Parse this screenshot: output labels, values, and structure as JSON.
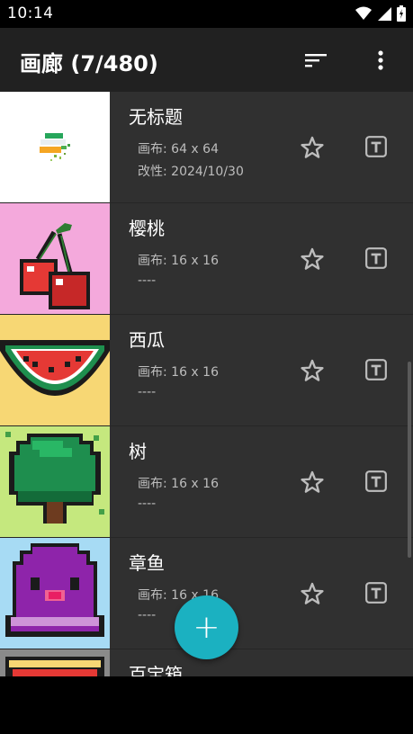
{
  "status": {
    "time": "10:14"
  },
  "appbar": {
    "title": "画廊 (7/480)"
  },
  "items": [
    {
      "title": "无标题",
      "canvas": "画布: 64 x 64",
      "modified": "改性: 2024/10/30"
    },
    {
      "title": "樱桃",
      "canvas": "画布: 16 x 16",
      "modified": "----"
    },
    {
      "title": "西瓜",
      "canvas": "画布: 16 x 16",
      "modified": "----"
    },
    {
      "title": "树",
      "canvas": "画布: 16 x 16",
      "modified": "----"
    },
    {
      "title": "章鱼",
      "canvas": "画布: 16 x 16",
      "modified": "----"
    },
    {
      "title": "百宝箱",
      "canvas": "",
      "modified": ""
    }
  ],
  "fab": {
    "label": "+"
  },
  "colors": {
    "appbar": "#212121",
    "list_bg": "#303030",
    "accent": "#1bb1c1"
  }
}
